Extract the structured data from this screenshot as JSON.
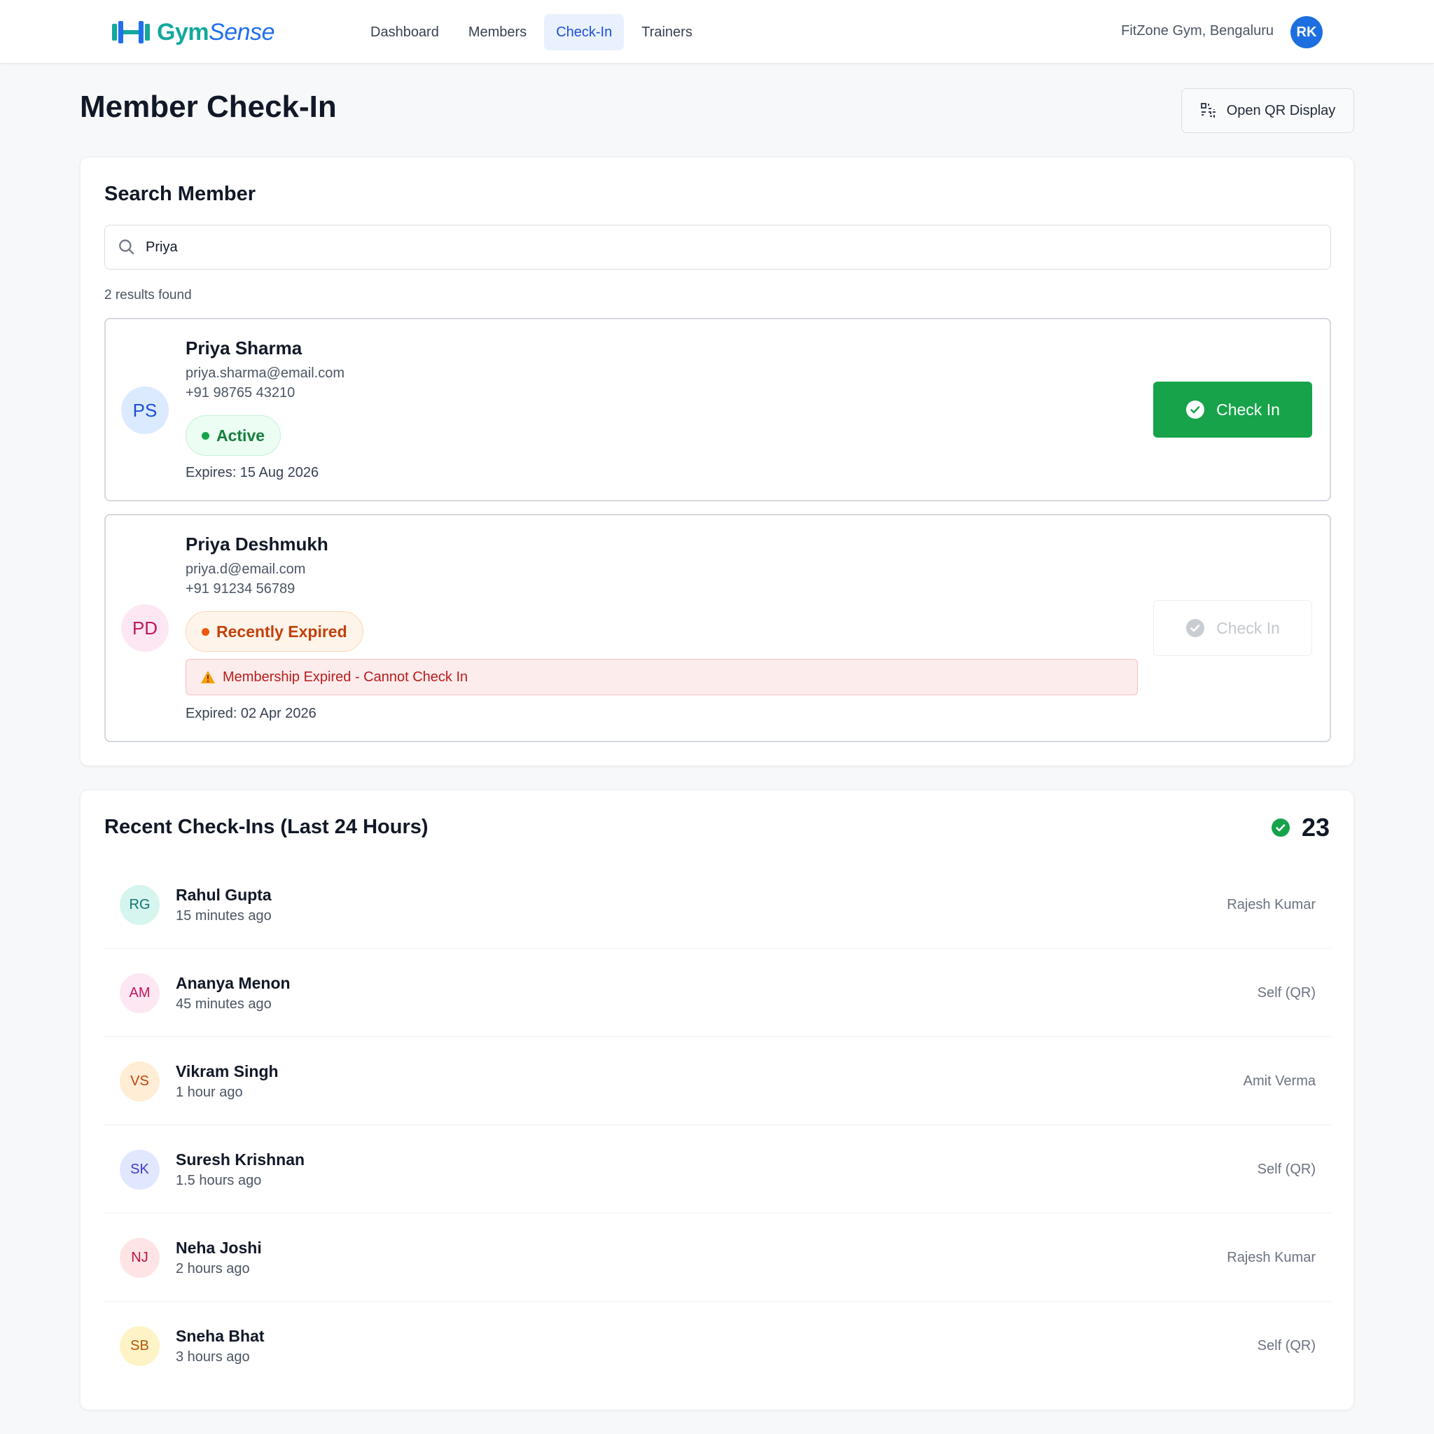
{
  "brand": {
    "name_part1": "Gym",
    "name_part2": "Sense",
    "logo_icon": "dumbbell-icon"
  },
  "nav": {
    "items": [
      {
        "label": "Dashboard",
        "active": false
      },
      {
        "label": "Members",
        "active": false
      },
      {
        "label": "Check-In",
        "active": true
      },
      {
        "label": "Trainers",
        "active": false
      }
    ]
  },
  "header": {
    "location": "FitZone Gym, Bengaluru",
    "user_initials": "RK"
  },
  "page": {
    "title": "Member Check-In",
    "qr_button_label": "Open QR Display",
    "qr_icon": "qr-code-icon"
  },
  "search": {
    "title": "Search Member",
    "value": "Priya",
    "results_text": "2 results found",
    "results": [
      {
        "initials": "PS",
        "name": "Priya Sharma",
        "email": "priya.sharma@email.com",
        "phone": "+91 98765 43210",
        "status": "Active",
        "expiry_text": "Expires: 15 Aug 2026",
        "button_label": "Check In",
        "button_enabled": true
      },
      {
        "initials": "PD",
        "name": "Priya Deshmukh",
        "email": "priya.d@email.com",
        "phone": "+91 91234 56789",
        "status": "Recently Expired",
        "warning": "Membership Expired - Cannot Check In",
        "expiry_text": "Expired: 02 Apr 2026",
        "button_label": "Check In",
        "button_enabled": false
      }
    ]
  },
  "recent": {
    "title": "Recent Check-Ins (Last 24 Hours)",
    "count": "23",
    "rows": [
      {
        "initials": "RG",
        "name": "Rahul Gupta",
        "time": "15 minutes ago",
        "by": "Rajesh Kumar"
      },
      {
        "initials": "AM",
        "name": "Ananya Menon",
        "time": "45 minutes ago",
        "by": "Self (QR)"
      },
      {
        "initials": "VS",
        "name": "Vikram Singh",
        "time": "1 hour ago",
        "by": "Amit Verma"
      },
      {
        "initials": "SK",
        "name": "Suresh Krishnan",
        "time": "1.5 hours ago",
        "by": "Self (QR)"
      },
      {
        "initials": "NJ",
        "name": "Neha Joshi",
        "time": "2 hours ago",
        "by": "Rajesh Kumar"
      },
      {
        "initials": "SB",
        "name": "Sneha Bhat",
        "time": "3 hours ago",
        "by": "Self (QR)"
      }
    ]
  },
  "colors": {
    "brand_teal": "#13a89e",
    "brand_blue": "#1f6feb",
    "success": "#16a34a",
    "warning": "#ea580c",
    "danger": "#b91c1c"
  }
}
